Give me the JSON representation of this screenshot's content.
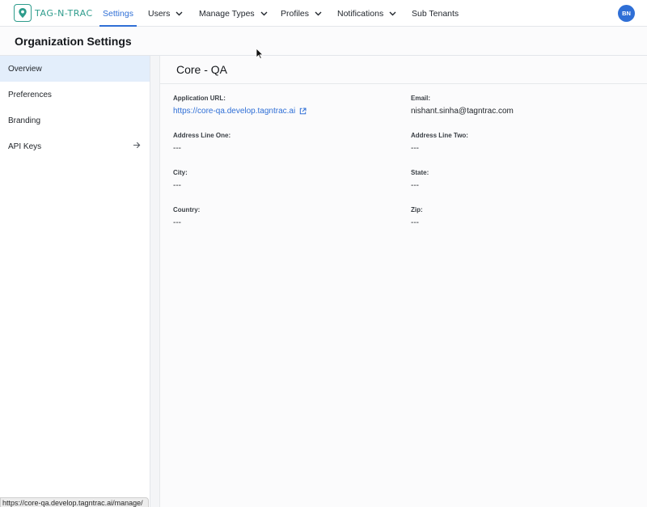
{
  "app": {
    "brand": "TAG-N-TRAC",
    "accent": "#2f6fd6",
    "brand_color": "#2e9c8c"
  },
  "nav": {
    "items": [
      {
        "label": "Settings",
        "active": true,
        "dropdown": false
      },
      {
        "label": "Users",
        "dropdown": true
      },
      {
        "label": "Manage Types",
        "dropdown": true
      },
      {
        "label": "Profiles",
        "dropdown": true
      },
      {
        "label": "Notifications",
        "dropdown": true
      },
      {
        "label": "Sub Tenants",
        "dropdown": false
      }
    ],
    "avatar_initials": "BN"
  },
  "header": {
    "title": "Organization Settings"
  },
  "sidebar": {
    "items": [
      {
        "label": "Overview",
        "active": true
      },
      {
        "label": "Preferences"
      },
      {
        "label": "Branding"
      },
      {
        "label": "API Keys",
        "icon": "arrow-right-icon"
      }
    ]
  },
  "main": {
    "org_name": "Core - QA",
    "fields": {
      "app_url_label": "Application URL:",
      "app_url_value": "https://core-qa.develop.tagntrac.ai",
      "email_label": "Email:",
      "email_value": "nishant.sinha@tagntrac.com",
      "addr1_label": "Address Line One:",
      "addr1_value": "---",
      "addr2_label": "Address Line Two:",
      "addr2_value": "---",
      "city_label": "City:",
      "city_value": "---",
      "state_label": "State:",
      "state_value": "---",
      "country_label": "Country:",
      "country_value": "---",
      "zip_label": "Zip:",
      "zip_value": "---"
    }
  },
  "status_bar": {
    "url": "https://core-qa.develop.tagntrac.ai/manage/"
  }
}
